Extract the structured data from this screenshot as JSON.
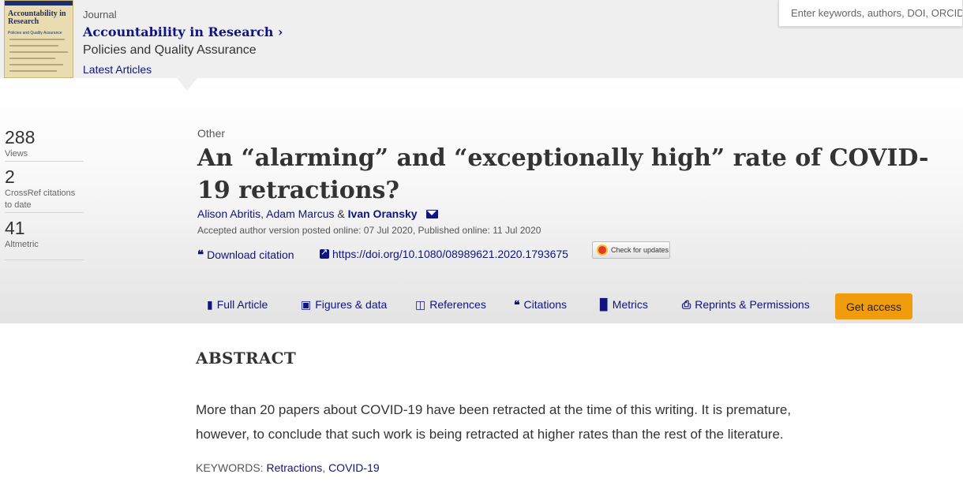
{
  "journal": {
    "cover": {
      "title": "Accountability in Research",
      "subtitle": "Policies and Quality Assurance"
    },
    "kicker": "Journal",
    "name": "Accountability in Research",
    "name_chevron": "›",
    "subtitle": "Policies and Quality Assurance",
    "latest_link": "Latest Articles"
  },
  "search": {
    "placeholder": "Enter keywords, authors, DOI, ORCID or"
  },
  "metrics": [
    {
      "value": "288",
      "label": "Views"
    },
    {
      "value": "2",
      "label": "CrossRef citations to date"
    },
    {
      "value": "41",
      "label": "Altmetric"
    }
  ],
  "article": {
    "type": "Other",
    "title": "An “alarming” and “exceptionally high” rate of COVID-19 retractions?",
    "authors": {
      "a1": "Alison Abritis",
      "sep1": ",",
      "a2": "Adam Marcus",
      "sep2": " & ",
      "a3": "Ivan Oransky"
    },
    "dates": "Accepted author version posted online: 07 Jul 2020, Published online: 11 Jul 2020",
    "download_citation": "Download citation",
    "doi": "https://doi.org/10.1080/08989621.2020.1793675",
    "check_updates": "Check for updates"
  },
  "tabs": [
    {
      "label": "Full Article",
      "icon": "document-icon"
    },
    {
      "label": "Figures & data",
      "icon": "image-icon"
    },
    {
      "label": "References",
      "icon": "book-icon"
    },
    {
      "label": "Citations",
      "icon": "quote-icon"
    },
    {
      "label": "Metrics",
      "icon": "bar-chart-icon"
    },
    {
      "label": "Reprints & Permissions",
      "icon": "print-icon"
    }
  ],
  "get_access": "Get access",
  "abstract": {
    "heading": "ABSTRACT",
    "line1": "More than 20 papers about COVID-19 have been retracted at the time of this writing. It is premature,",
    "line2": "however, to conclude that such work is being retracted at higher rates than the rest of the literature.",
    "keywords_label": "KEYWORDS:",
    "keywords": [
      "Retractions",
      "COVID-19"
    ],
    "keywords_sep": ","
  },
  "colors": {
    "link": "#10147e",
    "accent_button": "#f09c0d",
    "header_bg": "#efefef"
  }
}
